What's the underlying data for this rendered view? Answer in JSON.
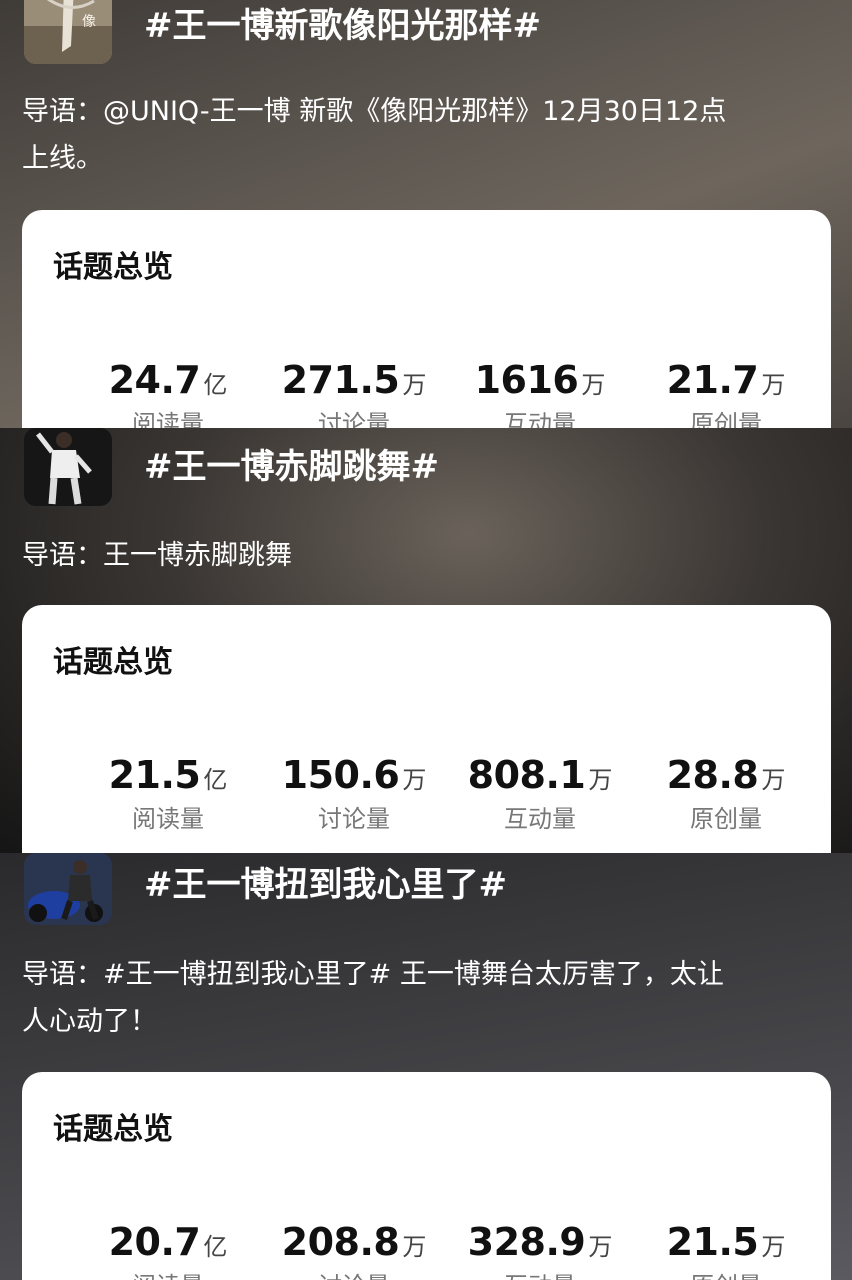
{
  "topics": [
    {
      "title": "#王一博新歌像阳光那样#",
      "intro_line1": "导语：@UNIQ-王一博 新歌《像阳光那样》12月30日12点",
      "intro_line2": "上线。",
      "overview_label": "话题总览",
      "stats": [
        {
          "value": "24.7",
          "unit": "亿",
          "label": "阅读量"
        },
        {
          "value": "271.5",
          "unit": "万",
          "label": "讨论量"
        },
        {
          "value": "1616",
          "unit": "万",
          "label": "互动量"
        },
        {
          "value": "21.7",
          "unit": "万",
          "label": "原创量"
        }
      ]
    },
    {
      "title": "#王一博赤脚跳舞#",
      "intro_line1": "导语：王一博赤脚跳舞",
      "intro_line2": "",
      "overview_label": "话题总览",
      "stats": [
        {
          "value": "21.5",
          "unit": "亿",
          "label": "阅读量"
        },
        {
          "value": "150.6",
          "unit": "万",
          "label": "讨论量"
        },
        {
          "value": "808.1",
          "unit": "万",
          "label": "互动量"
        },
        {
          "value": "28.8",
          "unit": "万",
          "label": "原创量"
        }
      ]
    },
    {
      "title": "#王一博扭到我心里了#",
      "intro_line1": "导语：#王一博扭到我心里了# 王一博舞台太厉害了，太让",
      "intro_line2": "人心动了！",
      "overview_label": "话题总览",
      "stats": [
        {
          "value": "20.7",
          "unit": "亿",
          "label": "阅读量"
        },
        {
          "value": "208.8",
          "unit": "万",
          "label": "讨论量"
        },
        {
          "value": "328.9",
          "unit": "万",
          "label": "互动量"
        },
        {
          "value": "21.5",
          "unit": "万",
          "label": "原创量"
        }
      ]
    }
  ]
}
